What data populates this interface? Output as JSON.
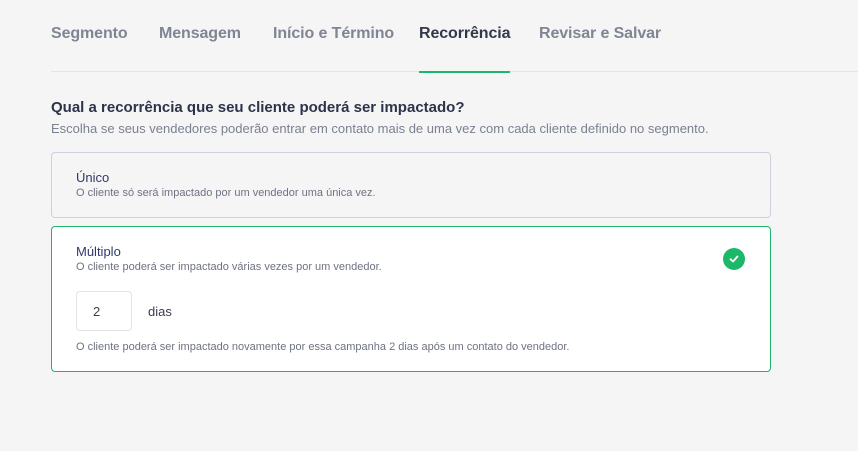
{
  "tabs": [
    {
      "label": "Segmento",
      "active": false
    },
    {
      "label": "Mensagem",
      "active": false
    },
    {
      "label": "Início e Término",
      "active": false
    },
    {
      "label": "Recorrência",
      "active": true
    },
    {
      "label": "Revisar e Salvar",
      "active": false
    }
  ],
  "question": {
    "title": "Qual a recorrência que seu cliente poderá ser impactado?",
    "subtitle": "Escolha se seus vendedores poderão entrar em contato mais de uma vez com cada cliente definido no segmento."
  },
  "options": {
    "unico": {
      "title": "Único",
      "description": "O cliente só será impactado por um vendedor uma única vez.",
      "selected": false
    },
    "multiplo": {
      "title": "Múltiplo",
      "description": "O cliente poderá ser impactado várias vezes por um vendedor.",
      "selected": true,
      "days_value": "2",
      "days_unit": "dias",
      "note": "O cliente poderá ser impactado novamente por essa campanha 2 dias após um contato do vendedor.",
      "check_icon": "check-circle-icon"
    }
  },
  "colors": {
    "accent": "#1cb869",
    "title": "#2e334a",
    "muted": "#7b8190"
  }
}
